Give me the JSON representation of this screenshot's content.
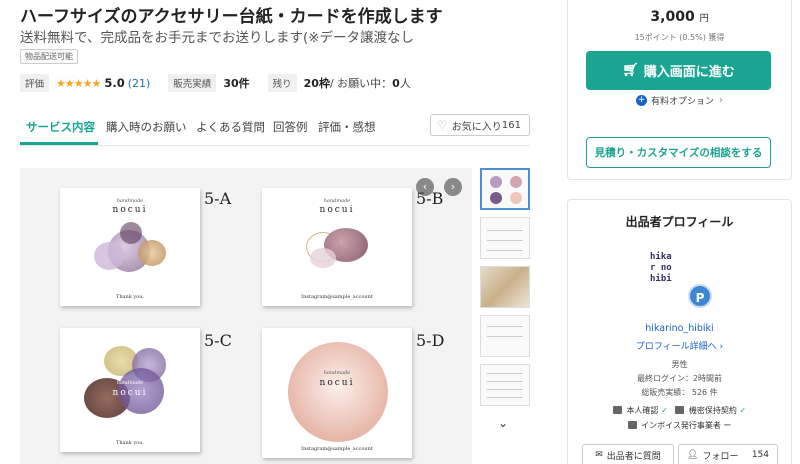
{
  "header": {
    "title": "ハーフサイズのアクセサリー台紙・カードを作成します",
    "subtitle": "送料無料で、完成品をお手元までお送りします(※データ譲渡なし",
    "tag": "物品配送可能"
  },
  "meta": {
    "rating_label": "評価",
    "stars": "★★★★★",
    "rating_value": "5.0",
    "rating_count": "(21)",
    "sales_label": "販売実績",
    "sales_value": "30件",
    "remaining_label": "残り",
    "remaining_value": "20枠",
    "requests_text": " / お願い中：",
    "requests_value": "0",
    "requests_unit": "人"
  },
  "tabs": [
    {
      "label": "サービス内容",
      "active": true
    },
    {
      "label": "購入時のお願い"
    },
    {
      "label": "よくある質問"
    },
    {
      "label": "回答例"
    },
    {
      "label": "評価・感想"
    }
  ],
  "favorite": {
    "label": "お気に入り",
    "count": "161"
  },
  "gallery": {
    "cards": [
      {
        "label": "5-A",
        "handmade": "handmade",
        "brand": "nocui",
        "footer": "Thank you."
      },
      {
        "label": "5-B",
        "handmade": "handmade",
        "brand": "nocui",
        "footer": "Instagram@sample_account"
      },
      {
        "label": "5-C",
        "handmade": "handmade",
        "brand": "nocui",
        "footer": "Thank you."
      },
      {
        "label": "5-D",
        "handmade": "handmade",
        "brand": "nocui",
        "footer": "Instagram@sample_account"
      }
    ],
    "prev_icon": "‹",
    "next_icon": "›"
  },
  "purchase": {
    "price": "3,000",
    "currency": "円",
    "points": "15ポイント (0.5%) 獲得",
    "buy_label": "購入画面に進む",
    "option_label": "有料オプション",
    "consult_label": "見積り・カスタマイズの相談をする"
  },
  "profile": {
    "title": "出品者プロフィール",
    "avatar_text": [
      "hika",
      "r no",
      "hibi"
    ],
    "badge": "P",
    "username": "hikarino_hibiki",
    "detail_link": "プロフィール詳細へ",
    "gender": "男性",
    "last_login": "最終ログイン：2時間前",
    "total_sales": "総販売実績： 526 件",
    "verify_identity": "本人確認",
    "verify_nda": "機密保持契約",
    "invoice": "インボイス発行事業者",
    "invoice_status": "ー",
    "contact_label": "出品者に質問",
    "follow_label": "フォロー",
    "follow_count": "154"
  },
  "colors": {
    "accent": "#1aa592",
    "link": "#1a63c8",
    "star": "#f5a623"
  }
}
